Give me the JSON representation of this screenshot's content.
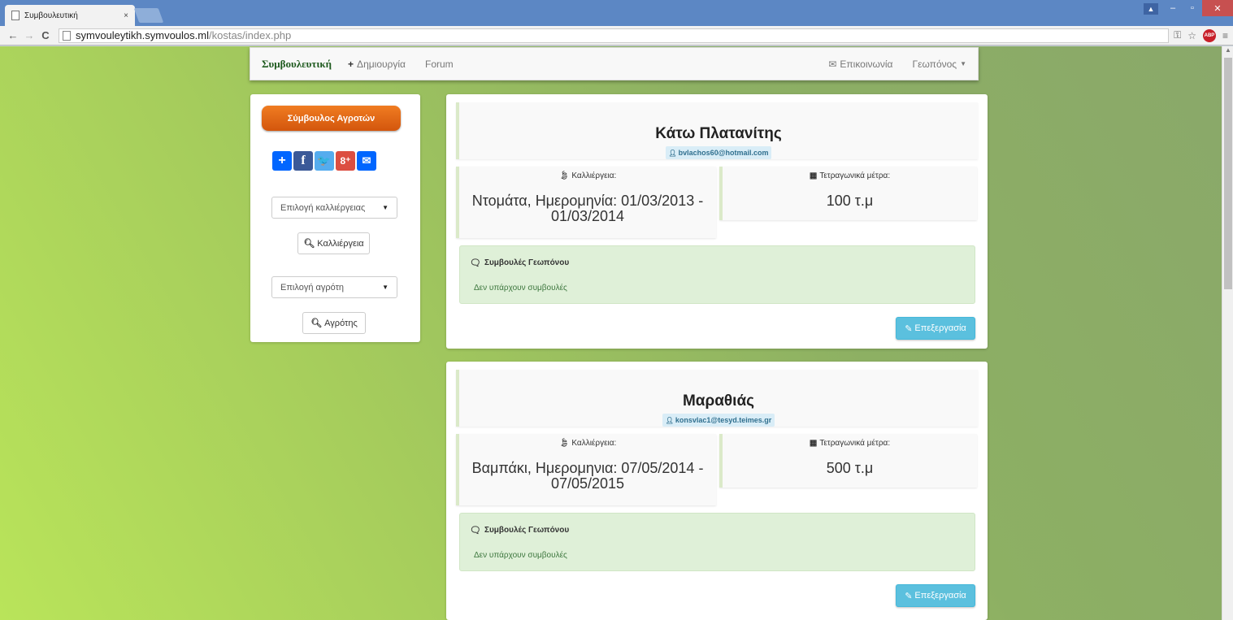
{
  "browser": {
    "tab_title": "Συμβουλευτική",
    "tab_close": "×",
    "url_host": "symvouleytikh.symvoulos.ml",
    "url_path": "/kostas/index.php",
    "abp_label": "ABP"
  },
  "navbar": {
    "brand": "Συμβουλευτική",
    "create_label": "Δημιουργία",
    "forum_label": "Forum",
    "contact_label": "Επικοινωνία",
    "user_label": "Γεωπόνος"
  },
  "sidebar": {
    "main_button": "Σύμβουλος Αγροτών",
    "crop_select": "Επιλογή καλλιέργειας",
    "crop_button": "Καλλιέργεια",
    "farmer_select": "Επιλογή αγρότη",
    "farmer_button": "Αγρότης"
  },
  "labels": {
    "crop": "Καλλιέργεια:",
    "area": "Τετραγωνικά μέτρα:",
    "advice_title": "Συμβουλές Γεωπόνου",
    "edit_button": "Επεξεργασία"
  },
  "cards": [
    {
      "title": "Κάτω Πλατανίτης",
      "email": "bvlachos60@hotmail.com",
      "crop_value": "Ντομάτα, Ημερομηνία: 01/03/2013 - 01/03/2014",
      "area_value": "100 τ.μ",
      "advice_text": "Δεν υπάρχουν συμβουλές"
    },
    {
      "title": "Μαραθιάς",
      "email": "konsvlac1@tesyd.teimes.gr",
      "crop_value": "Βαμπάκι, Ημερομηνια: 07/05/2014 - 07/05/2015",
      "area_value": "500 τ.μ",
      "advice_text": "Δεν υπάρχουν συμβουλές"
    }
  ],
  "colors": {
    "brand_green": "#1e5a1e",
    "orange_button": "#e8691a",
    "info_button": "#5bc0de",
    "advice_bg": "#dff0d8",
    "browser_frame": "#5c87c4"
  }
}
